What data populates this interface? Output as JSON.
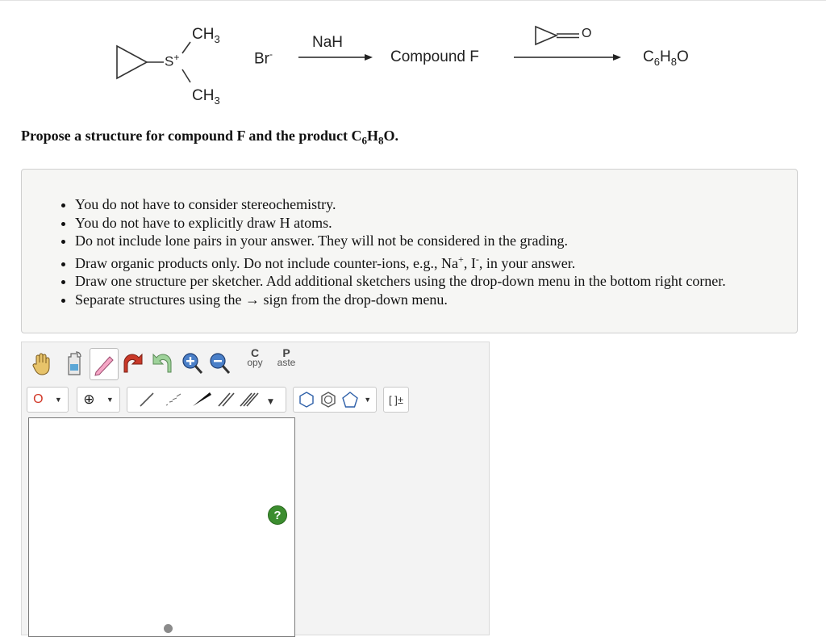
{
  "scheme": {
    "reagent_ch3_top": "CH3",
    "reagent_ch3_bottom": "CH3",
    "reagent_s": "S+",
    "counterion": "Br-",
    "step1_reagent": "NaH",
    "intermediate": "Compound F",
    "step2_reagent_atom": "O",
    "product": "C6H8O"
  },
  "question": "Propose a structure for compound F and the product C6H8O.",
  "instructions": [
    "You do not have to consider stereochemistry.",
    "You do not have to explicitly draw H atoms.",
    "Do not include lone pairs in your answer. They will not be considered in the grading.",
    "Draw organic products only. Do not include counter-ions, e.g., Na+, I-, in your answer.",
    "Draw one structure per sketcher. Add additional sketchers using the drop-down menu in the bottom right corner.",
    "Separate structures using the → sign from the drop-down menu."
  ],
  "sketcher": {
    "copy_label_top": "C",
    "copy_label_bottom": "opy",
    "paste_label_top": "P",
    "paste_label_bottom": "aste",
    "atom_selected": "O",
    "charge_symbol": "⊕",
    "bracket_label": "[ ]±",
    "help_label": "?",
    "icons": [
      "hand-icon",
      "eraser-bottle-icon",
      "pen-icon",
      "undo-icon",
      "redo-icon",
      "zoom-in-icon",
      "zoom-out-icon",
      "copy-icon",
      "paste-icon",
      "single-bond-icon",
      "wedge-hash-bond-icon",
      "wedge-bond-icon",
      "double-bond-icon",
      "triple-bond-icon",
      "hexagon-ring-icon",
      "benzene-ring-icon",
      "pentagon-ring-icon",
      "bracket-charge-icon"
    ]
  }
}
